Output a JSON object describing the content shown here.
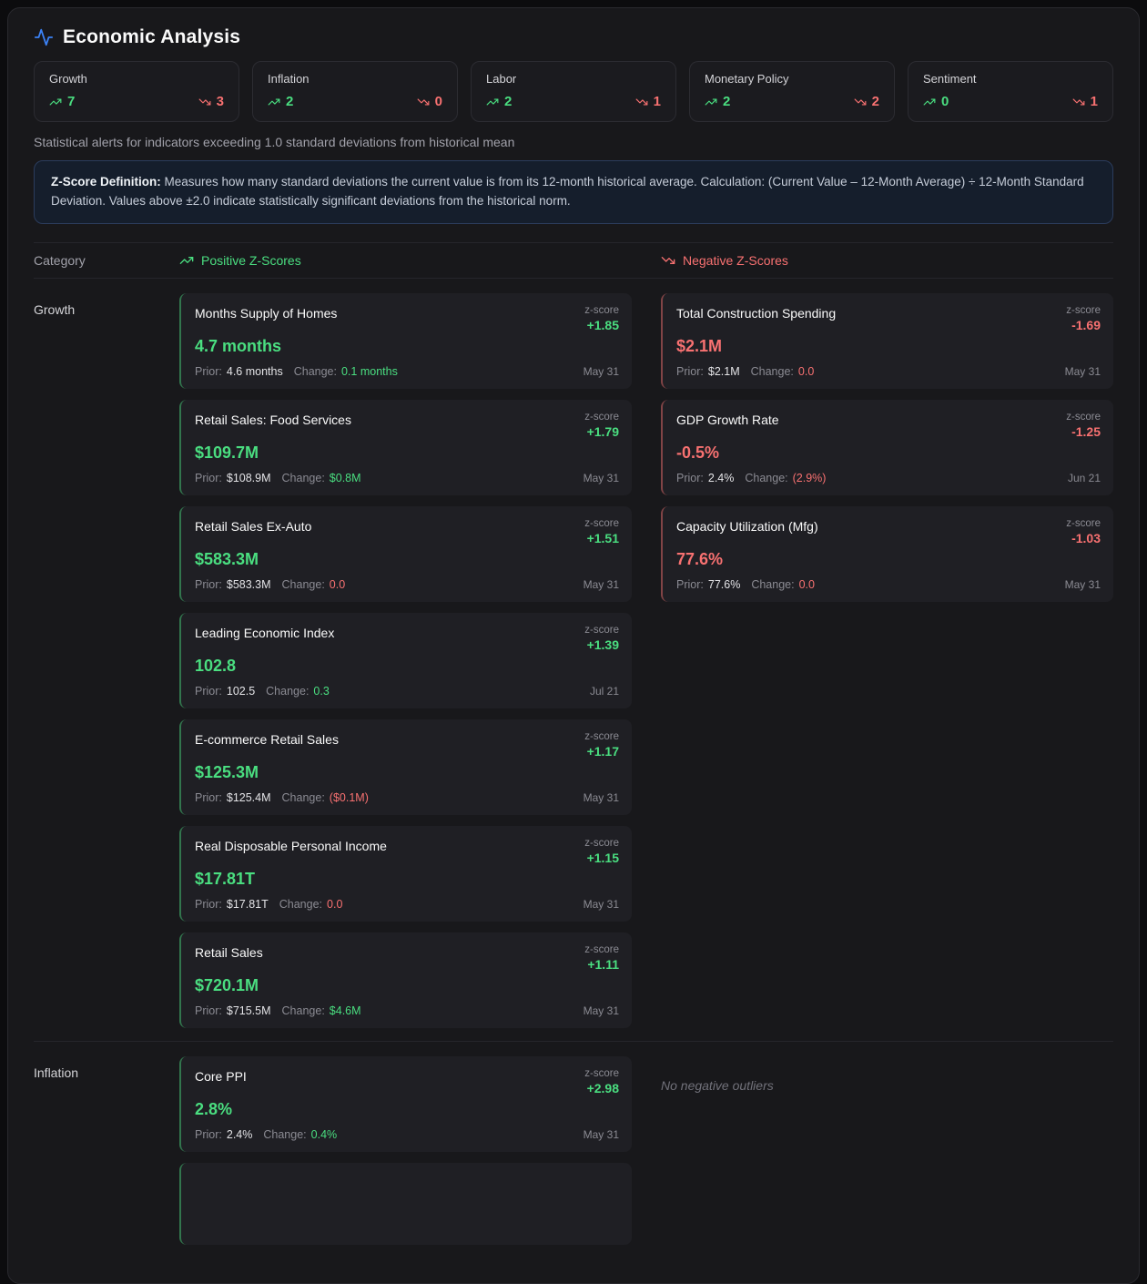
{
  "colors": {
    "green": "#4ade80",
    "red": "#f87171",
    "blue": "#3b82f6"
  },
  "header": {
    "title": "Economic Analysis"
  },
  "summary": [
    {
      "label": "Growth",
      "up": "7",
      "down": "3"
    },
    {
      "label": "Inflation",
      "up": "2",
      "down": "0"
    },
    {
      "label": "Labor",
      "up": "2",
      "down": "1"
    },
    {
      "label": "Monetary Policy",
      "up": "2",
      "down": "2"
    },
    {
      "label": "Sentiment",
      "up": "0",
      "down": "1"
    }
  ],
  "subtitle": "Statistical alerts for indicators exceeding 1.0 standard deviations from historical mean",
  "definition": {
    "label": "Z-Score Definition:",
    "text": "Measures how many standard deviations the current value is from its 12-month historical average. Calculation: (Current Value – 12-Month Average) ÷ 12-Month Standard Deviation. Values above ±2.0 indicate statistically significant deviations from the historical norm."
  },
  "table": {
    "category": "Category",
    "positive": "Positive Z-Scores",
    "negative": "Negative Z-Scores"
  },
  "labels": {
    "zscore": "z-score",
    "prior": "Prior:",
    "change": "Change:"
  },
  "sections": [
    {
      "label": "Growth",
      "positive": [
        {
          "title": "Months Supply of Homes",
          "value": "4.7 months",
          "z": "+1.85",
          "prior": "4.6 months",
          "change": "0.1 months",
          "date": "May 31"
        },
        {
          "title": "Retail Sales: Food Services",
          "value": "$109.7M",
          "z": "+1.79",
          "prior": "$108.9M",
          "change": "$0.8M",
          "date": "May 31"
        },
        {
          "title": "Retail Sales Ex-Auto",
          "value": "$583.3M",
          "z": "+1.51",
          "prior": "$583.3M",
          "change": "0.0",
          "date": "May 31"
        },
        {
          "title": "Leading Economic Index",
          "value": "102.8",
          "z": "+1.39",
          "prior": "102.5",
          "change": "0.3",
          "date": "Jul 21"
        },
        {
          "title": "E-commerce Retail Sales",
          "value": "$125.3M",
          "z": "+1.17",
          "prior": "$125.4M",
          "change": "($0.1M)",
          "date": "May 31"
        },
        {
          "title": "Real Disposable Personal Income",
          "value": "$17.81T",
          "z": "+1.15",
          "prior": "$17.81T",
          "change": "0.0",
          "date": "May 31"
        },
        {
          "title": "Retail Sales",
          "value": "$720.1M",
          "z": "+1.11",
          "prior": "$715.5M",
          "change": "$4.6M",
          "date": "May 31"
        }
      ],
      "negative": [
        {
          "title": "Total Construction Spending",
          "value": "$2.1M",
          "z": "-1.69",
          "prior": "$2.1M",
          "change": "0.0",
          "date": "May 31"
        },
        {
          "title": "GDP Growth Rate",
          "value": "-0.5%",
          "z": "-1.25",
          "prior": "2.4%",
          "change": "(2.9%)",
          "date": "Jun 21"
        },
        {
          "title": "Capacity Utilization (Mfg)",
          "value": "77.6%",
          "z": "-1.03",
          "prior": "77.6%",
          "change": "0.0",
          "date": "May 31"
        }
      ]
    },
    {
      "label": "Inflation",
      "positive": [
        {
          "title": "Core PPI",
          "value": "2.8%",
          "z": "+2.98",
          "prior": "2.4%",
          "change": "0.4%",
          "date": "May 31"
        }
      ],
      "negative": [],
      "no_negative": "No negative outliers"
    }
  ]
}
